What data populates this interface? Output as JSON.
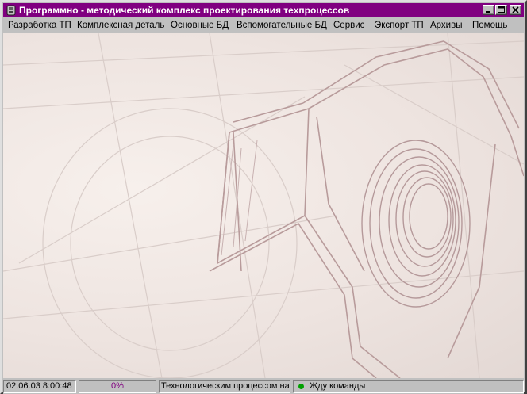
{
  "window": {
    "title": "Программно - методический комплекс проектирования техпроцессов",
    "controls": [
      "minimize-icon",
      "maximize-icon",
      "close-icon"
    ]
  },
  "menu": {
    "items": [
      {
        "label": "Разработка ТП"
      },
      {
        "label": "Комплексная деталь"
      },
      {
        "label": "Основные БД"
      },
      {
        "label": "Вспомогательные БД"
      },
      {
        "label": "Сервис"
      },
      {
        "label": "Экспорт ТП"
      },
      {
        "label": "Архивы"
      },
      {
        "label": "Помощь"
      }
    ]
  },
  "client": {
    "background": "hex-nut-sketch"
  },
  "status": {
    "datetime": "02.06.03 8:00:48",
    "progress_label": "0%",
    "progress_value": 0,
    "module": "Технологическим процессом на",
    "state_indicator_color": "#00a000",
    "message": "Жду команды"
  },
  "colors": {
    "titlebar": "#800080",
    "progress_text": "#800080"
  }
}
